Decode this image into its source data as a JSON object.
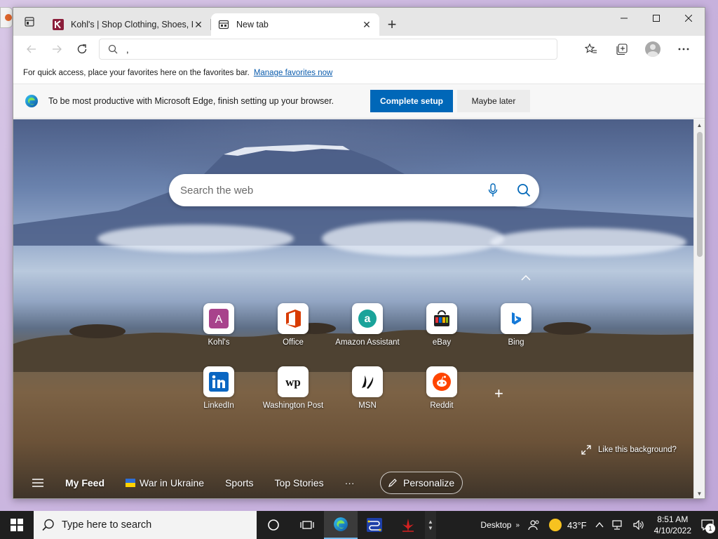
{
  "tabs": [
    {
      "title": "Kohl's | Shop Clothing, Shoes, Home, Kitchen, Bedding, Toys & More",
      "favicon": "kohls-favicon"
    },
    {
      "title": "New tab",
      "favicon": "newtab-favicon"
    }
  ],
  "address": {
    "value": ","
  },
  "favorites_bar": {
    "text": "For quick access, place your favorites here on the favorites bar.",
    "link": "Manage favorites now"
  },
  "infobar": {
    "message": "To be most productive with Microsoft Edge, finish setting up your browser.",
    "primary": "Complete setup",
    "secondary": "Maybe later"
  },
  "search": {
    "placeholder": "Search the web"
  },
  "tiles": [
    {
      "label": "Kohl's",
      "icon": "kohls-icon"
    },
    {
      "label": "Office",
      "icon": "office-icon"
    },
    {
      "label": "Amazon Assistant",
      "icon": "amazon-icon"
    },
    {
      "label": "eBay",
      "icon": "ebay-icon"
    },
    {
      "label": "Bing",
      "icon": "bing-icon"
    },
    {
      "label": "LinkedIn",
      "icon": "linkedin-icon"
    },
    {
      "label": "Washington Post",
      "icon": "washington-post-icon"
    },
    {
      "label": "MSN",
      "icon": "msn-icon"
    },
    {
      "label": "Reddit",
      "icon": "reddit-icon"
    }
  ],
  "like_background": "Like this background?",
  "feed": {
    "my_feed": "My Feed",
    "items": [
      "War in Ukraine",
      "Sports",
      "Top Stories"
    ],
    "more": "···",
    "personalize": "Personalize"
  },
  "taskbar": {
    "search_placeholder": "Type here to search",
    "desktop": "Desktop",
    "weather": "43°F",
    "time": "8:51 AM",
    "date": "4/10/2022",
    "notifications": "1"
  },
  "colors": {
    "edge_blue": "#0067b8",
    "taskbar": "#1f1f1f",
    "tab_strip": "#e6e6e6"
  }
}
